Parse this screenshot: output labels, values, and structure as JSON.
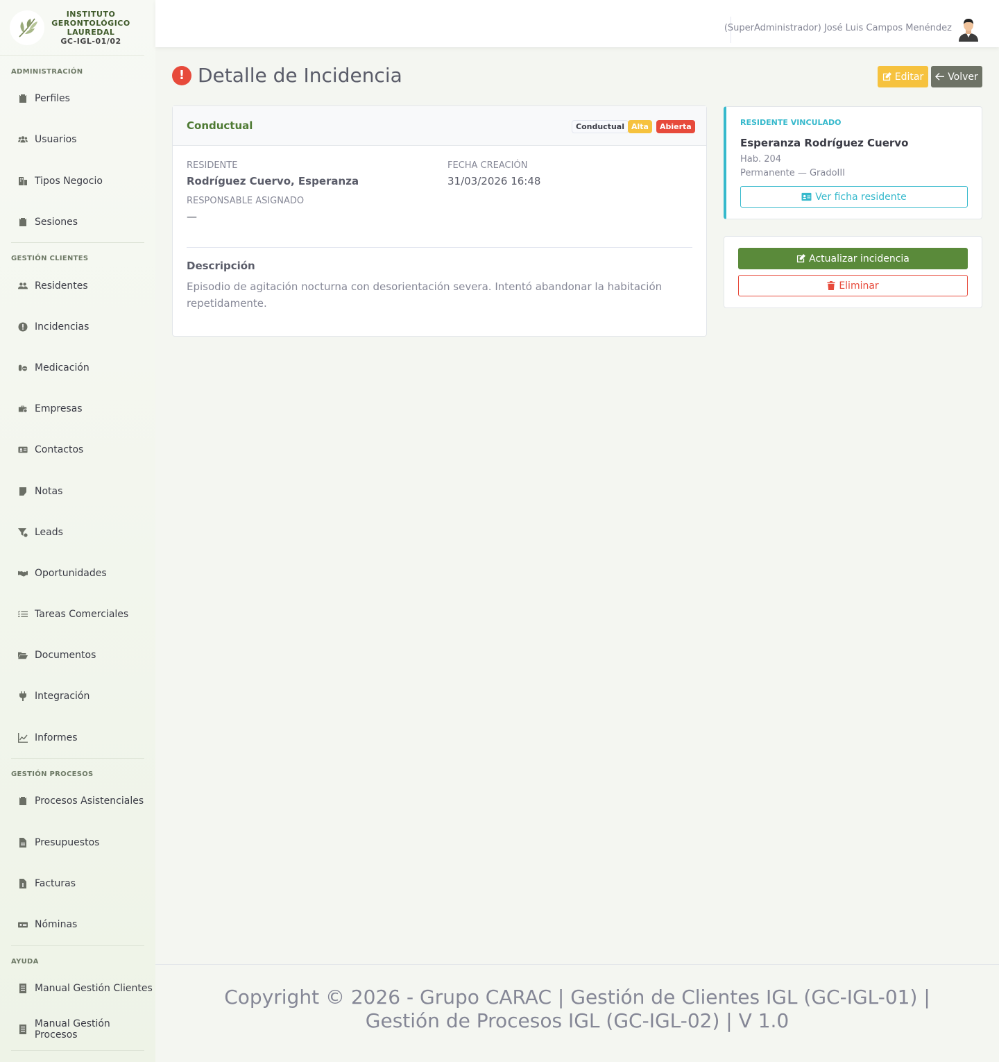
{
  "brand": {
    "line1": "INSTITUTO",
    "line2": "GERONTOLÓGICO",
    "line3": "LAUREDAL",
    "code": "GC-IGL-01/02"
  },
  "sidebar": {
    "sections": [
      {
        "heading": "Administración",
        "items": [
          {
            "label": "Perfiles",
            "icon": "clipboard-icon"
          },
          {
            "label": "Usuarios",
            "icon": "users-icon"
          },
          {
            "label": "Tipos Negocio",
            "icon": "building-icon"
          },
          {
            "label": "Sesiones",
            "icon": "clipboard-icon"
          }
        ]
      },
      {
        "heading": "Gestión Clientes",
        "items": [
          {
            "label": "Residentes",
            "icon": "user-group-icon"
          },
          {
            "label": "Incidencias",
            "icon": "exclamation-circle-icon"
          },
          {
            "label": "Medicación",
            "icon": "pills-icon"
          },
          {
            "label": "Empresas",
            "icon": "briefcase-icon"
          },
          {
            "label": "Contactos",
            "icon": "address-card-icon"
          },
          {
            "label": "Notas",
            "icon": "sticky-note-icon"
          },
          {
            "label": "Leads",
            "icon": "funnel-icon"
          },
          {
            "label": "Oportunidades",
            "icon": "handshake-icon"
          },
          {
            "label": "Tareas Comerciales",
            "icon": "tasks-icon"
          },
          {
            "label": "Documentos",
            "icon": "folder-open-icon"
          },
          {
            "label": "Integración",
            "icon": "plug-icon"
          },
          {
            "label": "Informes",
            "icon": "chart-line-icon"
          }
        ]
      },
      {
        "heading": "Gestión Procesos",
        "items": [
          {
            "label": "Procesos Asistenciales",
            "icon": "clipboard-icon"
          },
          {
            "label": "Presupuestos",
            "icon": "file-icon"
          },
          {
            "label": "Facturas",
            "icon": "invoice-icon"
          },
          {
            "label": "Nóminas",
            "icon": "money-icon"
          }
        ]
      },
      {
        "heading": "Ayuda",
        "items": [
          {
            "label": "Manual Gestión Clientes",
            "icon": "book-icon"
          },
          {
            "label": "Manual Gestión Procesos",
            "icon": "book-icon"
          }
        ]
      }
    ]
  },
  "topbar": {
    "user": "(SuperAdministrador) José Luis Campos Menéndez"
  },
  "page": {
    "title": "Detalle de Incidencia",
    "edit_label": "Editar",
    "back_label": "Volver"
  },
  "incident": {
    "category": "Conductual",
    "badges": {
      "type": "Conductual",
      "priority": "Alta",
      "status": "Abierta"
    },
    "resident_label": "Residente",
    "resident_value": "Rodríguez Cuervo, Esperanza",
    "created_label": "Fecha creación",
    "created_value": "31/03/2026 16:48",
    "assignee_label": "Responsable asignado",
    "assignee_value": "—",
    "description_title": "Descripción",
    "description_text": "Episodio de agitación nocturna con desorientación severa. Intentó abandonar la habitación repetidamente."
  },
  "linked_resident": {
    "label": "Residente vinculado",
    "name": "Esperanza Rodríguez Cuervo",
    "room": "Hab. 204",
    "stay": "Permanente — GradoIII",
    "button": "Ver ficha residente"
  },
  "actions": {
    "update": "Actualizar incidencia",
    "delete": "Eliminar"
  },
  "footer": {
    "text": "Copyright © 2026 - Grupo CARAC | Gestión de Clientes IGL (GC-IGL-01) | Gestión de Procesos IGL (GC-IGL-02) | V 1.0"
  },
  "colors": {
    "brand_green": "#4e7a33",
    "update_button": "#5a8a3a",
    "warning": "#f6c23e",
    "danger": "#e74a3b",
    "info": "#36b9cc",
    "secondary": "#6e7366"
  }
}
